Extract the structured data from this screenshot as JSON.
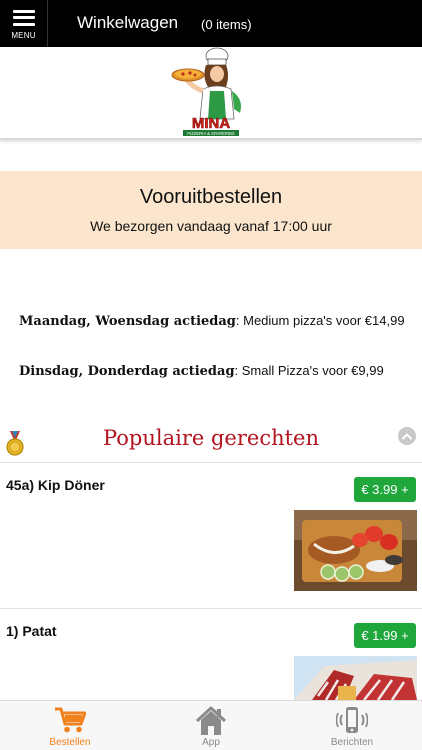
{
  "header": {
    "menu_label": "MENU",
    "title": "Winkelwagen",
    "items_count": "(0 items)"
  },
  "logo": {
    "brand_text": "MINA",
    "sub_text": "PIZZERIA & SPARERIBS"
  },
  "banner": {
    "title": "Vooruitbestellen",
    "subtitle": "We bezorgen vandaag vanaf 17:00 uur"
  },
  "promos": [
    {
      "day": "Maandag, Woensdag actiedag",
      "text": ": Medium pizza's voor €14,99"
    },
    {
      "day": "Dinsdag, Donderdag actiedag",
      "text": ": Small Pizza's voor €9,99"
    }
  ],
  "popular": {
    "title": "Populaire gerechten"
  },
  "products": [
    {
      "name": "45a)  Kip Döner",
      "price": "€ 3.99 +"
    },
    {
      "name": "1)  Patat",
      "price": "€ 1.99 +"
    }
  ],
  "bottom_nav": [
    {
      "label": "Bestellen",
      "active": true
    },
    {
      "label": "App",
      "active": false
    },
    {
      "label": "Berichten",
      "active": false
    }
  ],
  "colors": {
    "header_bg": "#000000",
    "banner_bg": "#fbe6cd",
    "popular_title": "#b3131f",
    "price_bg": "#1fa73b",
    "nav_active": "#f0821e",
    "nav_inactive": "#8a8a8a"
  },
  "icons": {
    "menu": "hamburger-icon",
    "medal": "medal-icon",
    "scroll_up": "chevron-up-icon",
    "cart": "cart-icon",
    "app": "home-icon",
    "messages": "phone-vibrate-icon"
  }
}
